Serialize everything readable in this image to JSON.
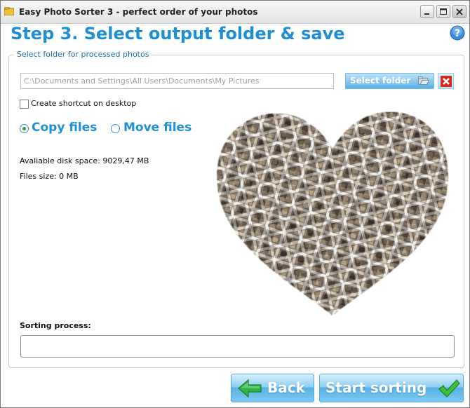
{
  "window": {
    "title": "Easy Photo Sorter 3 - perfect order of your photos"
  },
  "heading": "Step 3. Select output folder & save",
  "group": {
    "label": "Select folder for processed photos"
  },
  "output_path": {
    "value": "C:\\Documents and Settings\\All Users\\Documents\\My Pictures"
  },
  "select_folder_label": "Select folder",
  "shortcut": {
    "label": "Create shortcut on desktop",
    "checked": false
  },
  "mode": {
    "selected": "copy",
    "options": [
      "Copy files",
      "Move files"
    ]
  },
  "disk": {
    "available_label": "Avaliable disk space:",
    "available_value": "9029,47 MB",
    "files_size_label": "Files size:",
    "files_size_value": "0 MB"
  },
  "sorting": {
    "label": "Sorting process:",
    "progress": 0
  },
  "buttons": {
    "back": "Back",
    "start": "Start sorting"
  },
  "colors": {
    "accent": "#1e8ed6",
    "button_blue": "#58b0e4",
    "check_green": "#2ea02e",
    "close_red": "#d42a1e"
  },
  "icons": [
    "app-icon",
    "minimize-icon",
    "maximize-icon",
    "close-icon",
    "help-icon",
    "folder-icon",
    "clear-icon",
    "back-arrow-icon",
    "checkmark-icon"
  ]
}
